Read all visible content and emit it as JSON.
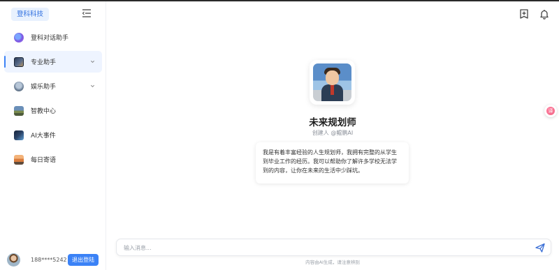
{
  "brand": {
    "label": "登科科技"
  },
  "sidebar": {
    "items": [
      {
        "label": "登科对话助手",
        "icon": "chat-bot-icon",
        "expandable": false,
        "active": false
      },
      {
        "label": "专业助手",
        "icon": "pro-assistant-icon",
        "expandable": true,
        "active": true
      },
      {
        "label": "娱乐助手",
        "icon": "entertainment-icon",
        "expandable": true,
        "active": false
      },
      {
        "label": "智教中心",
        "icon": "education-icon",
        "expandable": false,
        "active": false
      },
      {
        "label": "AI大事件",
        "icon": "ai-events-icon",
        "expandable": false,
        "active": false
      },
      {
        "label": "每日寄语",
        "icon": "daily-quote-icon",
        "expandable": false,
        "active": false
      }
    ]
  },
  "user": {
    "phone": "188****5242",
    "logout_label": "退出登陆"
  },
  "agent": {
    "name": "未来规划师",
    "creator": "创建人 @鲲鹏AI",
    "description": "我是有着丰富经验的人生规划师，我拥有完整的从学生到毕业工作的经历。我可以帮助你了解许多学校无法学到的内容，让你在未来的生活中少踩坑。"
  },
  "input": {
    "placeholder": "输入消息..."
  },
  "footer": {
    "disclaimer": "内容由AI生成，请注意辨别"
  },
  "floating": {
    "label": "译"
  },
  "colors": {
    "accent": "#3b82f6",
    "brand_bg": "#e8f1fe",
    "brand_text": "#2f6fe0"
  }
}
